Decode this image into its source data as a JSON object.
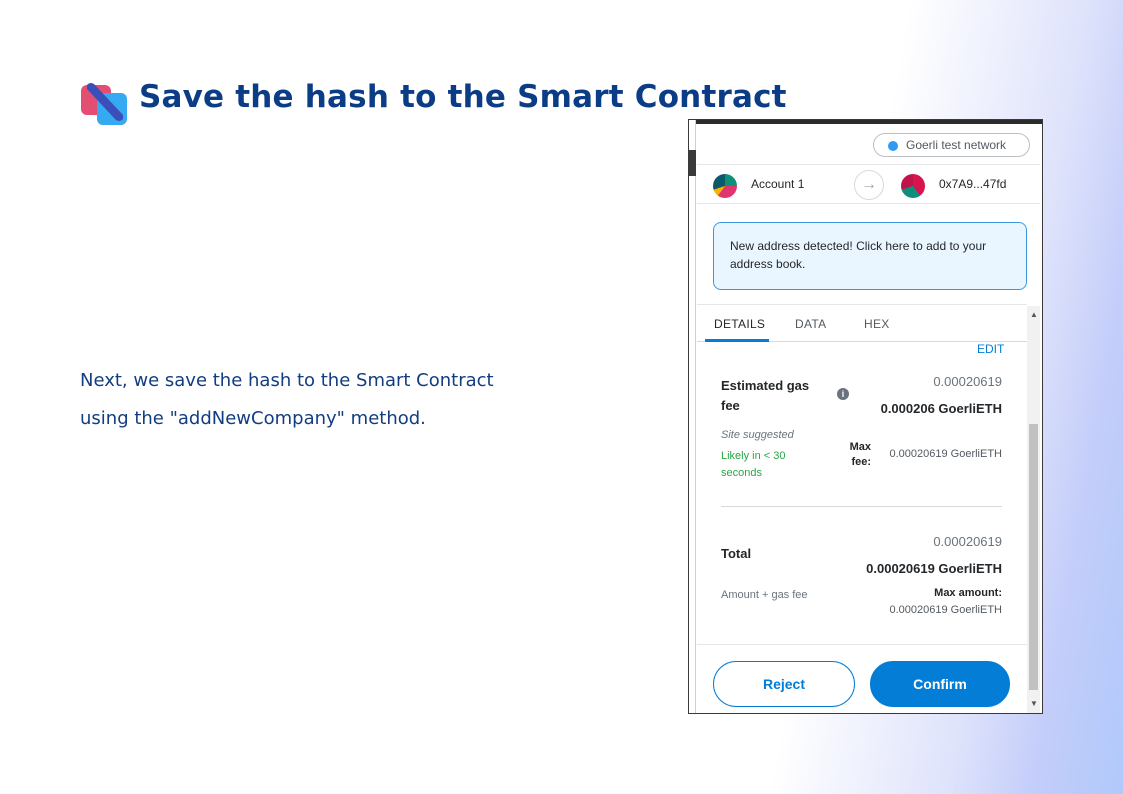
{
  "slide": {
    "title": "Save the hash to the Smart Contract",
    "body_line1": "Next, we save the hash to the Smart Contract",
    "body_line2": "using the \"addNewCompany\" method."
  },
  "wallet": {
    "network": "Goerli test network",
    "from_account": "Account 1",
    "to_address": "0x7A9...47fd",
    "notice": "New address detected! Click here to add to your address book.",
    "tabs": [
      "DETAILS",
      "DATA",
      "HEX"
    ],
    "active_tab": "DETAILS",
    "edit_label": "EDIT",
    "gas": {
      "title": "Estimated gas fee",
      "secondary": "0.00020619",
      "primary": "0.000206 GoerliETH",
      "site_suggested": "Site suggested",
      "likely": "Likely in < 30 seconds",
      "max_fee_label": "Max fee:",
      "max_fee_value": "0.00020619 GoerliETH"
    },
    "total": {
      "title": "Total",
      "secondary": "0.00020619",
      "primary": "0.00020619 GoerliETH",
      "amount_gas": "Amount + gas fee",
      "max_amount_label": "Max amount:",
      "max_amount_value": "0.00020619 GoerliETH"
    },
    "reject_label": "Reject",
    "confirm_label": "Confirm"
  },
  "colors": {
    "title": "#0b3c86",
    "accent_blue": "#037dd6",
    "success_green": "#28a745",
    "notice_bg": "#eaf6ff"
  },
  "icons": [
    "logo-icon",
    "network-dot-icon",
    "arrow-right-icon",
    "info-icon",
    "scroll-up-icon",
    "scroll-down-icon"
  ]
}
